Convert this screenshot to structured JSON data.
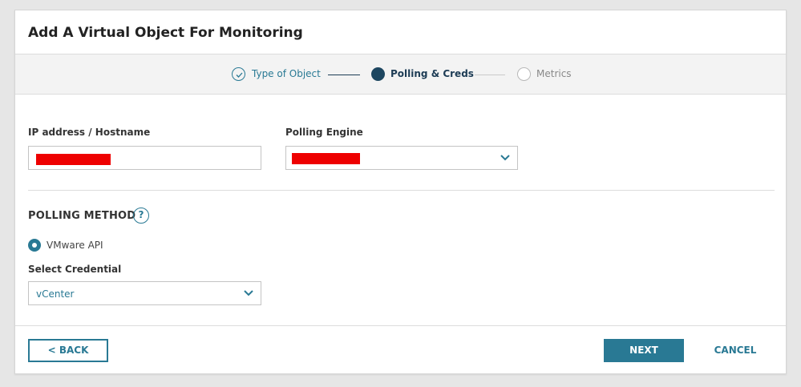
{
  "dialog": {
    "title": "Add A Virtual Object For Monitoring"
  },
  "stepper": {
    "steps": [
      {
        "label": "Type of Object",
        "state": "completed"
      },
      {
        "label": "Polling & Creds",
        "state": "active"
      },
      {
        "label": "Metrics",
        "state": "pending"
      }
    ]
  },
  "form": {
    "ip_label": "IP address / Hostname",
    "ip_value": "",
    "engine_label": "Polling Engine",
    "engine_value": "",
    "section_title": "POLLING METHOD",
    "help_icon": "?",
    "polling_option": {
      "label": "VMware API",
      "selected": true
    },
    "credential_label": "Select Credential",
    "credential_value": "vCenter"
  },
  "footer": {
    "back_label": "< BACK",
    "next_label": "NEXT",
    "cancel_label": "CANCEL"
  },
  "colors": {
    "accent": "#297994",
    "active_step": "#1d4660",
    "redaction": "#ee0000"
  },
  "icons": {
    "completed_step": "check-circle-icon",
    "select": "chevron-down-icon",
    "help": "help-icon"
  }
}
